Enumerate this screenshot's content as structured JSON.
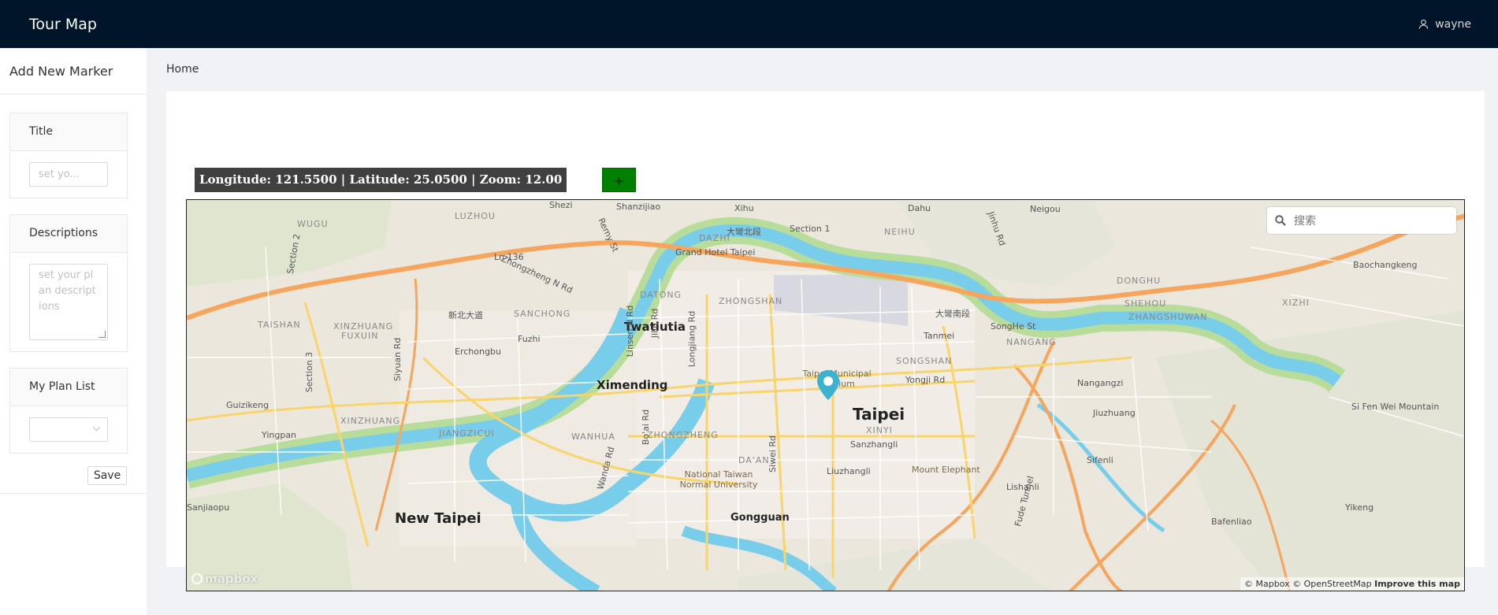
{
  "header": {
    "title": "Tour Map",
    "username": "wayne",
    "user_icon": "user-icon"
  },
  "sider": {
    "title": "Add New Marker",
    "title_card": {
      "label": "Title",
      "placeholder": "set yo..."
    },
    "descriptions_card": {
      "label": "Descriptions",
      "placeholder": "set your plan descriptions"
    },
    "plan_list_card": {
      "label": "My Plan List",
      "selected": ""
    },
    "save_label": "Save"
  },
  "breadcrumb": "Home",
  "map_info": {
    "text": "Longitude: 121.5500 | Latitude: 25.0500 | Zoom: 12.00",
    "add_label": "+"
  },
  "map": {
    "search_placeholder": "搜索",
    "logo": "mapbox",
    "attribution": {
      "mapbox": "© Mapbox",
      "osm": "© OpenStreetMap",
      "improve": "Improve this map"
    },
    "places": {
      "shezi": "Shezi",
      "shanzijiao": "Shanzijiao",
      "xihu": "Xihu",
      "dahu": "Dahu",
      "neigou": "Neigou",
      "wugu": "WUGU",
      "luzhou": "LUZHOU",
      "dazhi": "DAZHI",
      "neihu": "NEIHU",
      "donghu": "DONGHU",
      "baochangkeng": "Baochangkeng",
      "taishan": "TAISHAN",
      "xinzhuang": "XINZHUANG",
      "fuxuin": "FUXUIN",
      "sanchong": "SANCHONG",
      "datong": "DATONG",
      "zhongshan": "ZHONGSHAN",
      "twatiutia": "Twatiutia",
      "erchongbu": "Erchongbu",
      "fuzhi": "Fuzhi",
      "tanmei": "Tanmei",
      "nangang": "NANGANG",
      "shehou": "SHEHOU",
      "zhangshuwan": "ZHANGSHUWAN",
      "xizhi": "XIZHI",
      "songshan": "SONGSHAN",
      "ximending": "Ximending",
      "taipei": "Taipei",
      "nangangzi": "Nangangzi",
      "guizikeng": "Guizikeng",
      "xinzhuang2": "XINZHUANG",
      "jiangzicui": "JIANGZICUI",
      "wanhua": "WANHUA",
      "zhongzheng": "ZHONGZHENG",
      "xinyi": "XINYI",
      "sanzhangli": "Sanzhangli",
      "jiuzhuang": "Jiuzhuang",
      "yingpan": "Yingpan",
      "daan": "DA'AN",
      "sifenli": "Sifenli",
      "liuzhangli": "Liuzhangli",
      "lishanli": "Lishanli",
      "new_taipei": "New Taipei",
      "gongguan": "Gongguan",
      "sanjiaopu": "Sanjiaopu",
      "yikeng": "Yikeng",
      "bafenliao": "Bafenliao",
      "sifenwei": "Si Fen Wei Mountain",
      "mount_elephant": "Mount Elephant",
      "grand_hotel": "Grand Hotel Taipei",
      "stadium": "Taipei Municipal Stadium",
      "ntnu": "National Taiwan Normal University",
      "dazhi_cn": "大彎北段",
      "dazhi_s": "大彎南段",
      "section1": "Section 1",
      "section2": "Section 2",
      "section3": "Section 3",
      "zhongzheng_rd": "Zhongzheng N Rd",
      "xinbei_rd": "新北大道",
      "ln136": "Ln 136",
      "jinhu_rd": "Jinhu Rd",
      "songhe_st": "SongHe St",
      "yongji_rd": "Yongji Rd",
      "linsen_rd": "Linsen N Rd",
      "jilin_rd": "Jilin Rd",
      "longjiang_rd": "Longjiang Rd",
      "siwei_rd": "Siwei Rd",
      "wanda_rd": "Wanda Rd",
      "boai_rd": "Bo'ai Rd",
      "siyuan_rd": "Siyuan Rd",
      "renyi_st": "Remy St",
      "fude_tunnel": "Fude Tunnel"
    }
  },
  "colors": {
    "header_bg": "#001529",
    "content_bg": "#f0f2f5",
    "add_button": "#008000",
    "coord_bg": "#404040",
    "pin": "#3bb2d0"
  }
}
